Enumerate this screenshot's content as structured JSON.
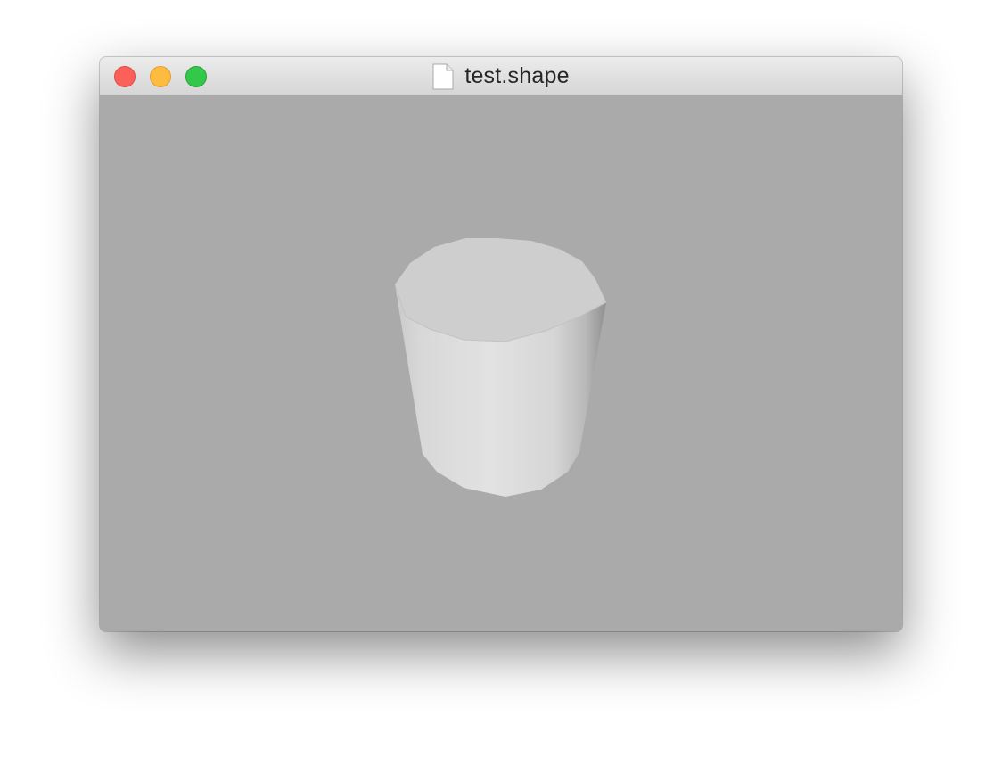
{
  "window": {
    "title": "test.shape",
    "controls": {
      "close": "close-button",
      "minimize": "minimize-button",
      "zoom": "zoom-button"
    },
    "title_icon": "document-icon"
  },
  "viewport": {
    "background_color": "#aaaaaa",
    "object": "cylinder",
    "object_top_color": "#cecece",
    "object_side_color": "#e0e0e0"
  }
}
